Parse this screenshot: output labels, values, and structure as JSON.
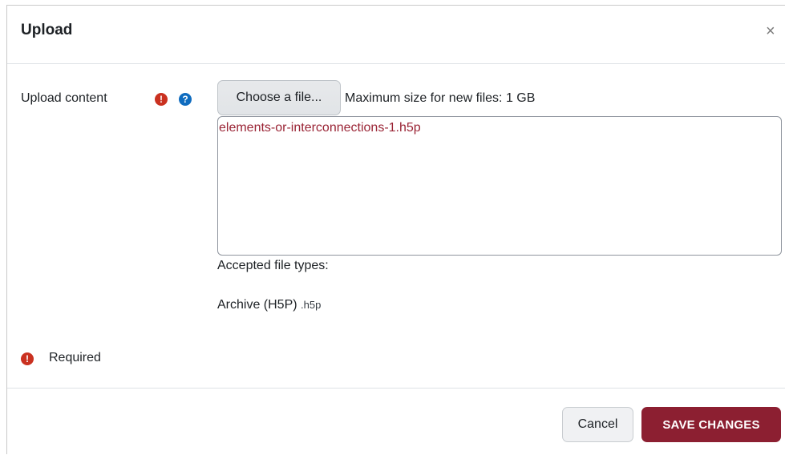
{
  "modal": {
    "title": "Upload",
    "close_glyph": "×"
  },
  "field": {
    "label": "Upload content",
    "required_icon": "exclamation-circle-icon",
    "help_icon": "question-circle-icon",
    "choose_button": "Choose a file...",
    "max_size": "Maximum size for new files: 1 GB",
    "selected_file": "elements-or-interconnections-1.h5p",
    "accepted_label": "Accepted file types:",
    "accepted_types": [
      {
        "name": "Archive (H5P)",
        "extension": ".h5p"
      }
    ]
  },
  "required_note": "Required",
  "footer": {
    "cancel_label": "Cancel",
    "save_label": "SAVE CHANGES"
  },
  "colors": {
    "required_red": "#ca3120",
    "help_blue": "#0f6cbf",
    "link_maroon": "#9a2435",
    "save_button_bg": "#8c1f31"
  }
}
